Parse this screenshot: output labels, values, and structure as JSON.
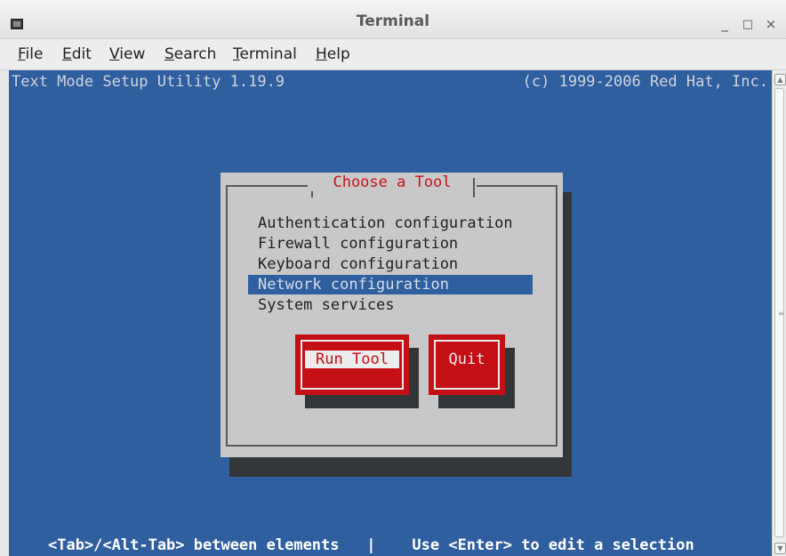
{
  "window": {
    "title": "Terminal",
    "minimize_glyph": "_",
    "maximize_glyph": "□",
    "close_glyph": "×"
  },
  "menu": {
    "file": {
      "accel": "F",
      "rest": "ile"
    },
    "edit": {
      "accel": "E",
      "rest": "dit"
    },
    "view": {
      "accel": "V",
      "rest": "iew"
    },
    "search": {
      "accel": "S",
      "rest": "earch"
    },
    "terminal": {
      "accel": "T",
      "rest": "erminal"
    },
    "help": {
      "accel": "H",
      "rest": "elp"
    }
  },
  "terminal": {
    "header_left": "Text Mode Setup Utility 1.19.9",
    "header_right": "(c) 1999-2006 Red Hat, Inc.",
    "footer": "<Tab>/<Alt-Tab> between elements   |    Use <Enter> to edit a selection"
  },
  "dialog": {
    "title": "Choose a Tool",
    "options": [
      "Authentication configuration",
      "Firewall configuration",
      "Keyboard configuration",
      "Network configuration",
      "System services"
    ],
    "selected_index": 3,
    "buttons": {
      "run": "Run Tool",
      "quit": "Quit"
    },
    "focused_button": "run"
  },
  "colors": {
    "terminal_bg": "#2f5f9f",
    "dialog_bg": "#c8c8c8",
    "button_red": "#c40f16",
    "title_red": "#c8151b",
    "shadow": "#333638"
  }
}
